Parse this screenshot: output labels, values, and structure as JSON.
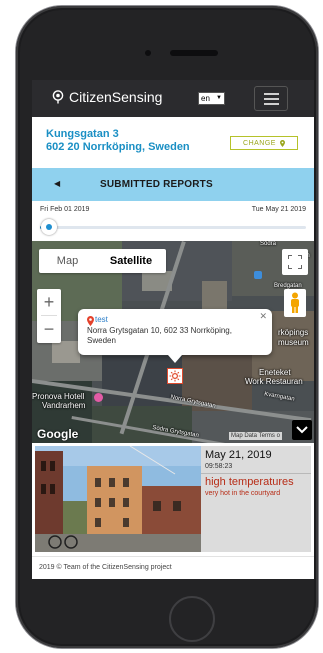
{
  "navbar": {
    "brand": "CitizenSensing",
    "language": "en"
  },
  "location": {
    "street": "Kungsgatan 3",
    "city": "602 20 Norrköping, Sweden",
    "change_label": "CHANGE"
  },
  "reports_bar": {
    "title": "SUBMITTED REPORTS"
  },
  "timeline": {
    "start_date": "Fri Feb 01 2019",
    "end_date": "Tue May 21 2019",
    "position": 0.02
  },
  "map": {
    "type_map": "Map",
    "type_satellite": "Satellite",
    "selected_type": "Satellite",
    "infowindow": {
      "title": "test",
      "address": "Norra Grytsgatan 10, 602 33 Norrköping, Sweden"
    },
    "labels": {
      "pronova": "Pronova Hotell",
      "vandrarhem": "Vandrarhem",
      "eneteket": "Eneteket",
      "work": "Work Restauran",
      "museum": "museum",
      "norrkopings": "rköpings",
      "bredgatan": "Bredgatan",
      "norra_grytsgatan": "Norra Grytsgatan",
      "kvarngatan": "Kvarngatan",
      "sodra_grytsgatan": "Södra Grytsgatan",
      "sodra": "Södra",
      "gatan": "atan"
    },
    "google": "Google",
    "attribution": "Map Data  Terms o"
  },
  "report": {
    "date": "May 21, 2019",
    "time": "09:58:23",
    "title": "high temperatures",
    "description": "very hot in the courtyard"
  },
  "footer": {
    "text": "2019 © Team of the CitizenSensing project"
  },
  "colors": {
    "accent": "#1a8fc4",
    "reports_bar": "#8fd1ee",
    "report_red": "#b72c16",
    "change_green": "#9aa61c"
  }
}
